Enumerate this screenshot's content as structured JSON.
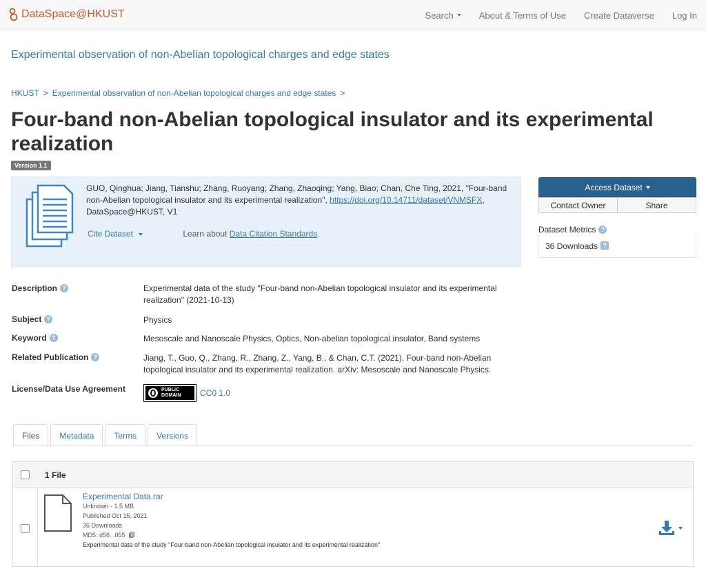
{
  "navbar": {
    "brand": "DataSpace@HKUST",
    "search": "Search",
    "about": "About & Terms of Use",
    "create": "Create Dataverse",
    "login": "Log In"
  },
  "dataverse": {
    "title": "Experimental observation of non-Abelian topological charges and edge states"
  },
  "breadcrumb": {
    "root": "HKUST",
    "parent": "Experimental observation of non-Abelian topological charges and edge states",
    "sep": ">"
  },
  "dataset": {
    "title": "Four-band non-Abelian topological insulator and its experimental realization",
    "version": "Version 1.1"
  },
  "citation": {
    "text_before": "GUO, Qinghua; Jiang, Tianshu; Zhang, Ruoyang; Zhang, Zhaoqing; Yang, Biao; Chan, Che Ting, 2021, \"Four-band non-Abelian topological insulator and its experimental realization\", ",
    "doi": "https://doi.org/10.14711/dataset/VNMSFX",
    "text_after": ", DataSpace@HKUST, V1",
    "cite_label": "Cite Dataset",
    "learn_prefix": "Learn about ",
    "learn_link": "Data Citation Standards",
    "learn_suffix": "."
  },
  "sidebar": {
    "access": "Access Dataset",
    "contact": "Contact Owner",
    "share": "Share",
    "metrics_label": "Dataset Metrics",
    "downloads": "36 Downloads"
  },
  "metadata": {
    "description_label": "Description",
    "description": "Experimental data of the study \"Four-band non-Abelian topological insulator and its experimental realization\" (2021-10-13)",
    "subject_label": "Subject",
    "subject": "Physics",
    "keyword_label": "Keyword",
    "keyword": "Mesoscale and Nanoscale Physics, Optics, Non-abelian topological insulator, Band systems",
    "related_label": "Related Publication",
    "related": "Jiang, T., Guo, Q., Zhang, R., Zhang, Z., Yang, B., & Chan, C.T. (2021). Four-band non-Abelian topological insulator and its experimental realization. arXiv: Mesoscale and Nanoscale Physics.",
    "license_label": "License/Data Use Agreement",
    "cc0_badge_line1": "PUBLIC",
    "cc0_badge_line2": "DOMAIN",
    "license": "CC0 1.0"
  },
  "tabs": [
    "Files",
    "Metadata",
    "Terms",
    "Versions"
  ],
  "files": {
    "count": "1 File",
    "name": "Experimental Data.rar",
    "type_size": "Unknown - 1.5 MB",
    "published": "Published Oct 15, 2021",
    "downloads": "36 Downloads",
    "md5": "MD5: d56...055",
    "description": "Experimental data of the study \"Four-band non-Abelian topological insulator and its experimental realization\""
  },
  "colors": {
    "brand": "#c55b28",
    "link": "#337ab7",
    "primary_button": "#286090",
    "citation_bg": "#e8f1f9"
  }
}
